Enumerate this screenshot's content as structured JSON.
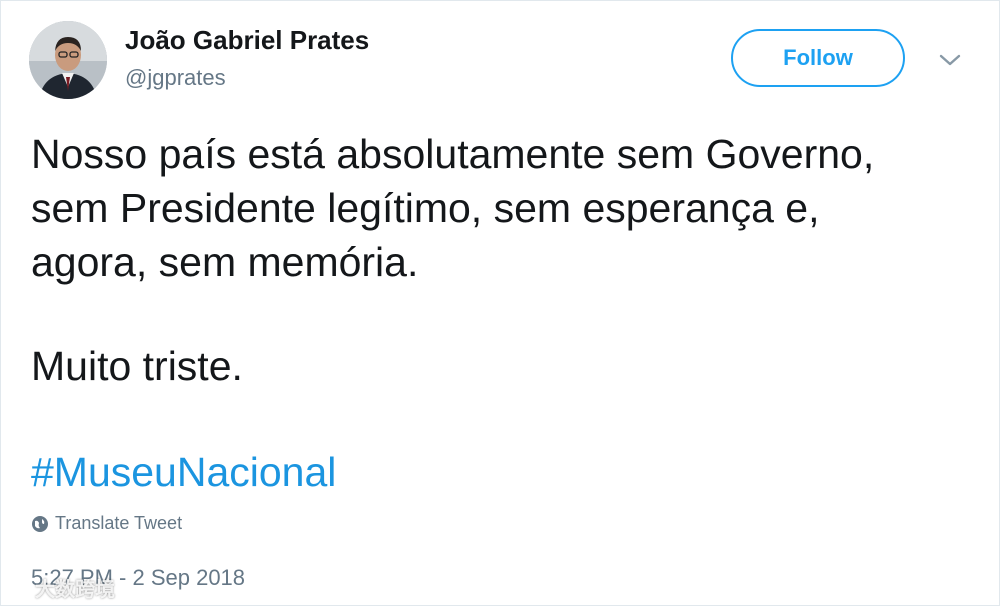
{
  "author": {
    "name": "João Gabriel Prates",
    "handle": "@jgprates",
    "avatar_icon": "profile-photo"
  },
  "follow_button": {
    "label": "Follow",
    "color": "#1da1f2"
  },
  "menu_icon": "chevron-down-icon",
  "tweet": {
    "lines": [
      "Nosso país está absolutamente sem Governo,",
      "sem Presidente legítimo, sem esperança e,",
      "agora, sem memória."
    ],
    "closing": "Muito triste.",
    "hashtag": "#MuseuNacional",
    "hashtag_color": "#1b95e0"
  },
  "translate": {
    "label": "Translate Tweet",
    "icon": "globe-icon"
  },
  "timestamp": "5:27 PM - 2 Sep 2018",
  "watermark": {
    "text": "大数跨境",
    "icon": "logo-icon"
  }
}
